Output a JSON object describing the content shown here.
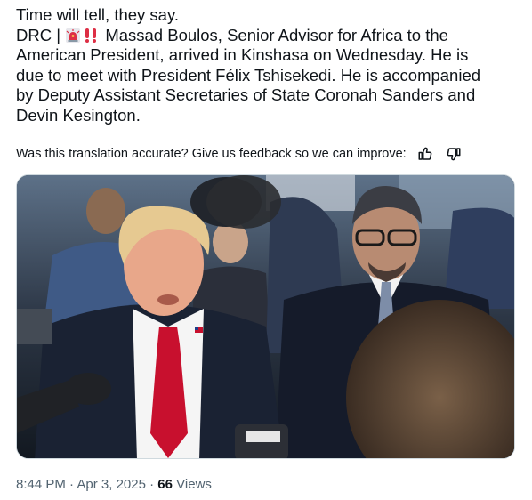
{
  "tweet": {
    "lines": [
      "Time will tell, they say.",
      "Massad Boulos, Senior Advisor for Africa to the",
      "American President, arrived in Kinshasa on Wednesday. He is",
      "due to meet with President Félix Tshisekedi. He is accompanied",
      "by Deputy Assistant Secretaries of State Coronah Sanders and",
      "Devin Kesington."
    ],
    "prefix": "DRC |",
    "emojis": [
      "police-light-icon",
      "double-exclamation-icon"
    ]
  },
  "feedback": {
    "prompt": "Was this translation accurate? Give us feedback so we can improve:",
    "thumbs_up_icon": "thumbs-up-icon",
    "thumbs_down_icon": "thumbs-down-icon"
  },
  "media": {
    "type": "photo"
  },
  "meta": {
    "time": "8:44 PM",
    "separator": "·",
    "date": "Apr 3, 2025",
    "views_count": "66",
    "views_label": "Views"
  },
  "colors": {
    "text": "#0f1419",
    "secondary": "#536471",
    "border": "#cfd9de",
    "tie_red": "#c8102e",
    "emoji_red": "#e0245e"
  }
}
